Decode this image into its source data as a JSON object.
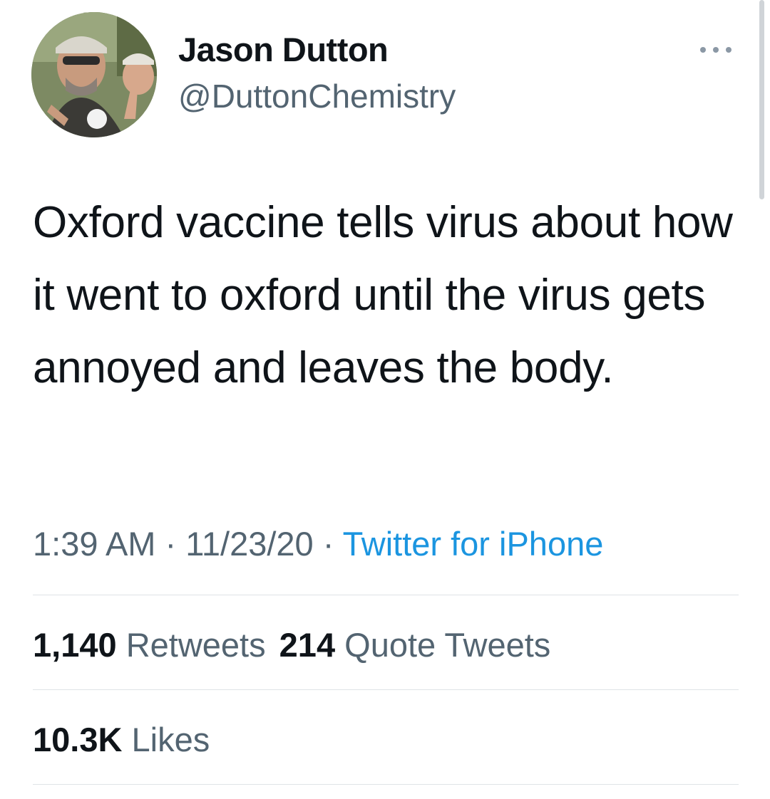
{
  "author": {
    "name": "Jason Dutton",
    "handle": "@DuttonChemistry"
  },
  "tweet": {
    "text": "Oxford vaccine tells virus about how it went to oxford until the virus gets annoyed and leaves the body.",
    "time": "1:39 AM",
    "date": "11/23/20",
    "separator": "·",
    "source": "Twitter for iPhone"
  },
  "stats": {
    "retweets_count": "1,140",
    "retweets_label": "Retweets",
    "quotes_count": "214",
    "quotes_label": "Quote Tweets",
    "likes_count": "10.3K",
    "likes_label": "Likes"
  },
  "icons": {
    "more": "more-options-icon",
    "avatar": "profile-photo"
  },
  "colors": {
    "text_primary": "#0f1419",
    "text_secondary": "#536471",
    "link": "#1b95e0",
    "divider": "#dfe3e6"
  }
}
